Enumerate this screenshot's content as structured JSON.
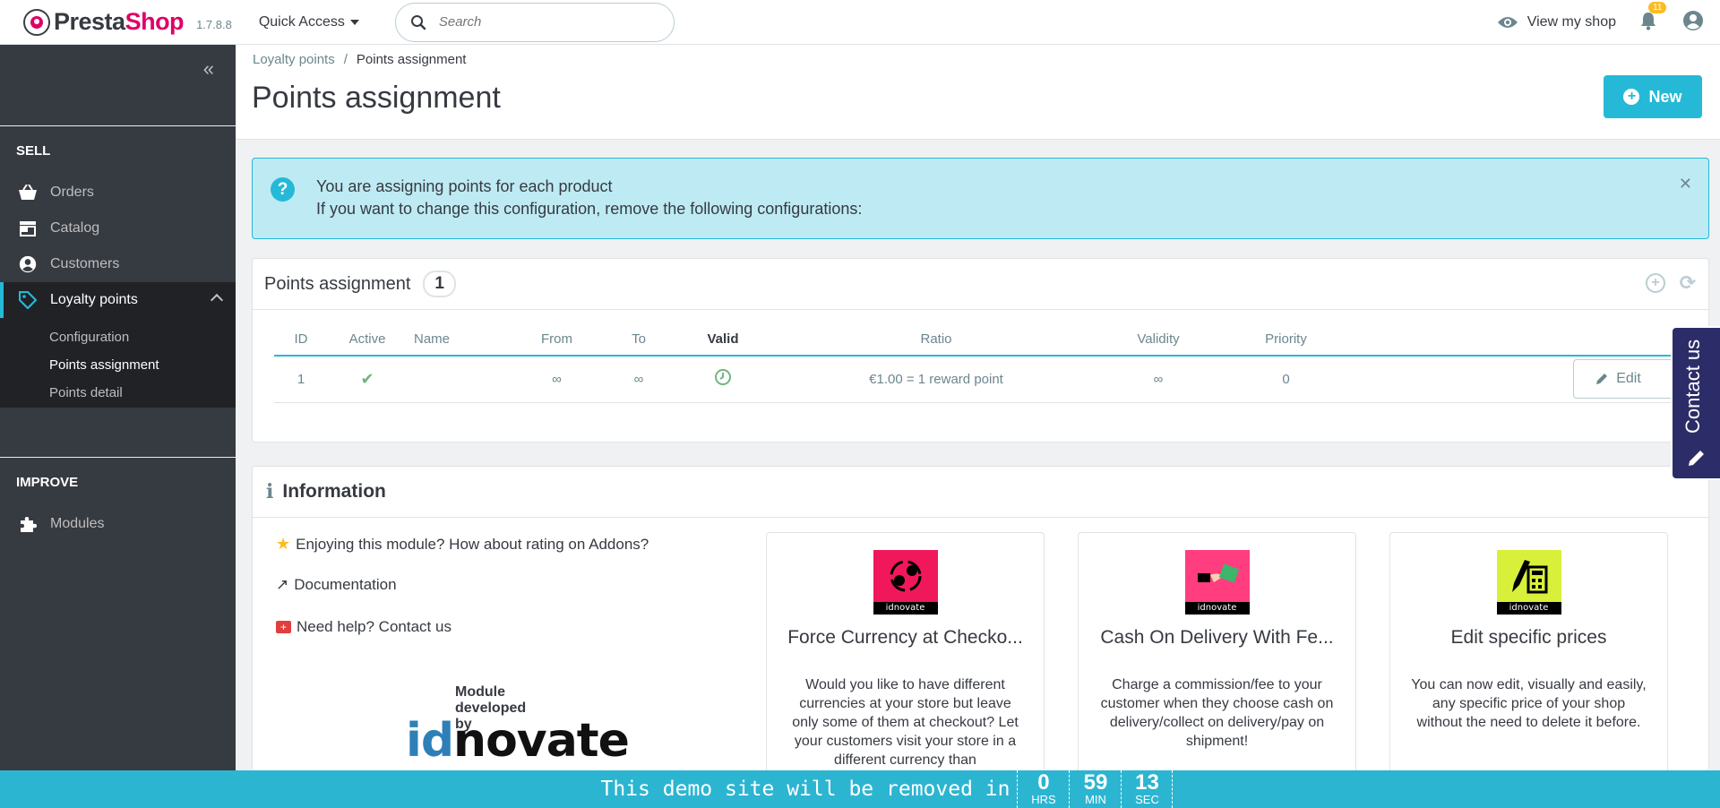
{
  "header": {
    "logo_prefix": "Presta",
    "logo_suffix": "Shop",
    "version": "1.7.8.8",
    "quick_access": "Quick Access",
    "search_placeholder": "Search",
    "view_shop": "View my shop",
    "notifications_count": "11"
  },
  "sidebar": {
    "sections": [
      {
        "title": "SELL"
      },
      {
        "title": "IMPROVE"
      }
    ],
    "items": [
      {
        "label": "Orders",
        "icon": "basket-icon"
      },
      {
        "label": "Catalog",
        "icon": "store-icon"
      },
      {
        "label": "Customers",
        "icon": "user-circle-icon"
      },
      {
        "label": "Loyalty points",
        "icon": "tag-icon"
      },
      {
        "label": "Modules",
        "icon": "puzzle-icon"
      }
    ],
    "subitems": [
      {
        "label": "Configuration"
      },
      {
        "label": "Points assignment"
      },
      {
        "label": "Points detail"
      }
    ]
  },
  "page": {
    "breadcrumb_parent": "Loyalty points",
    "breadcrumb_current": "Points assignment",
    "title": "Points assignment",
    "new_button": "New"
  },
  "alert": {
    "line1": "You are assigning points for each product",
    "line2": "If you want to change this configuration, remove the following configurations:"
  },
  "grid": {
    "title": "Points assignment",
    "count": "1",
    "columns": [
      "ID",
      "Active",
      "Name",
      "From",
      "To",
      "Valid",
      "Ratio",
      "Validity",
      "Priority"
    ],
    "rows": [
      {
        "id": "1",
        "name": "",
        "from": "∞",
        "to": "∞",
        "ratio": "€1.00 = 1 reward point",
        "validity": "∞",
        "priority": "0"
      }
    ],
    "edit_label": "Edit"
  },
  "info": {
    "title": "Information",
    "rate": "Enjoying this module? How about rating on Addons?",
    "docs": "Documentation",
    "help": "Need help? Contact us",
    "developed_by": "Module developed by",
    "dev_logo_id": "id",
    "dev_logo_rest": "novate",
    "modules": [
      {
        "title": "Force Currency at Checko...",
        "desc": "Would you like to have different currencies at your store but leave only some of them at checkout? Let your customers visit your store in a different currency than",
        "color": "#f0185a",
        "brand": "idnovate"
      },
      {
        "title": "Cash On Delivery With Fe...",
        "desc": "Charge a commission/fee to your customer when they choose cash on delivery/collect on delivery/pay on shipment!",
        "color": "#ff3d7f",
        "brand": "idnovate"
      },
      {
        "title": "Edit specific prices",
        "desc": "You can now edit, visually and easily, any specific price of your shop without the need to delete it before.",
        "color": "#d9f03a",
        "brand": "idnovate"
      }
    ]
  },
  "demo_bar": {
    "text": "This demo site will be removed in",
    "hours": "0",
    "hours_label": "HRS",
    "minutes": "59",
    "minutes_label": "MIN",
    "seconds": "13",
    "seconds_label": "SEC"
  },
  "contact_tab": "Contact us",
  "colors": {
    "accent": "#25b9d7",
    "brand": "#df0067",
    "sidebar": "#363a41"
  }
}
